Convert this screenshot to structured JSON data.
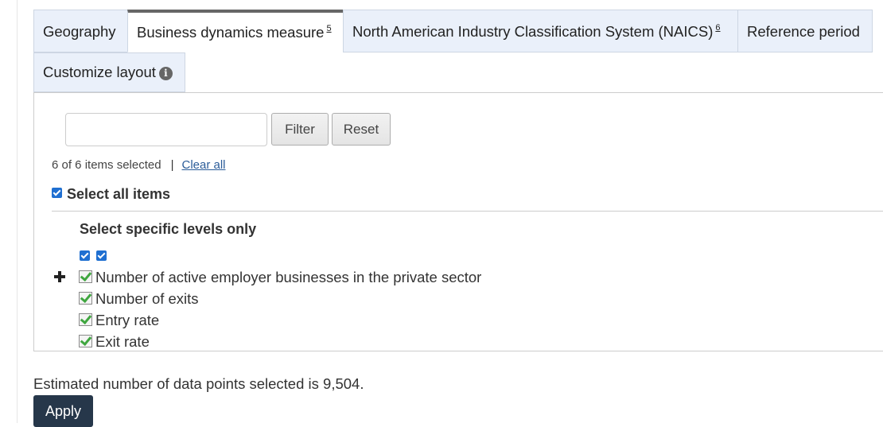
{
  "tabs": [
    {
      "label": "Geography",
      "sup": ""
    },
    {
      "label": "Business dynamics measure",
      "sup": "5"
    },
    {
      "label": "North American Industry Classification System (NAICS)",
      "sup": "6"
    },
    {
      "label": "Reference period",
      "sup": ""
    },
    {
      "label": "Customize layout",
      "sup": ""
    }
  ],
  "active_tab": "Business dynamics measure",
  "filter": {
    "value": "",
    "placeholder": "",
    "filter_label": "Filter",
    "reset_label": "Reset"
  },
  "selection": {
    "count_text": "6 of 6 items selected",
    "separator": "|",
    "clear_all_label": "Clear all"
  },
  "select_all_label": "Select all items",
  "levels_title": "Select specific levels only",
  "items": [
    {
      "label": "Number of active employer businesses in the private sector",
      "expandable": true,
      "checked": true
    },
    {
      "label": "Number of exits",
      "expandable": false,
      "checked": true
    },
    {
      "label": "Entry rate",
      "expandable": false,
      "checked": true
    },
    {
      "label": "Exit rate",
      "expandable": false,
      "checked": true
    }
  ],
  "estimate_text": "Estimated number of data points selected is 9,504.",
  "apply_label": "Apply",
  "colors": {
    "apply_bg": "#26374a",
    "tab_bg": "#eaf0fa",
    "link": "#2b5c99",
    "check_green": "#3fa63f"
  }
}
